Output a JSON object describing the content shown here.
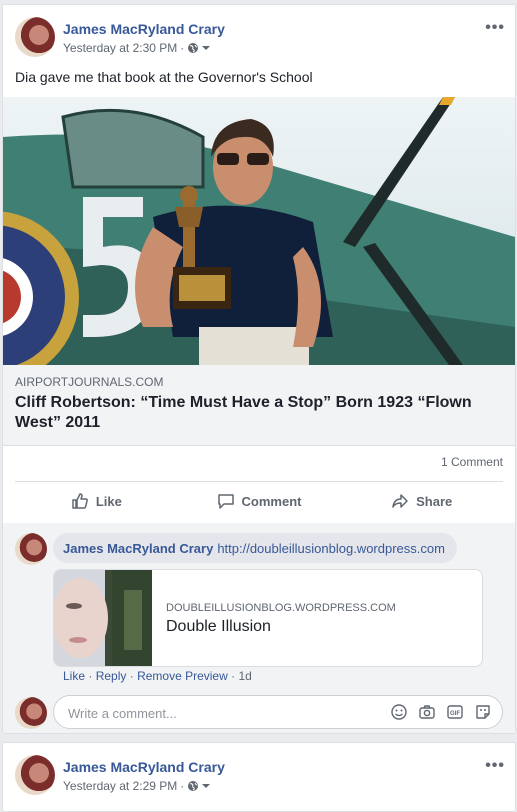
{
  "post1": {
    "author": "James MacRyland Crary",
    "timestamp": "Yesterday at 2:30 PM",
    "privacy_icon": "globe-icon",
    "more_label": "•••",
    "text": "Dia gave me that book at the Governor's School",
    "link": {
      "domain": "AIRPORTJOURNALS.COM",
      "title": "Cliff Robertson: “Time Must Have a Stop” Born 1923 “Flown West” 2011"
    },
    "comment_count": "1 Comment",
    "actions": {
      "like": "Like",
      "comment": "Comment",
      "share": "Share"
    },
    "comment": {
      "author": "James MacRyland Crary",
      "link_text": "http://doubleillusionblog.wordpress.com",
      "preview": {
        "domain": "DOUBLEILLUSIONBLOG.WORDPRESS.COM",
        "title": "Double Illusion"
      },
      "actions": {
        "like": "Like",
        "reply": "Reply",
        "remove_preview": "Remove Preview",
        "age": "1d"
      }
    },
    "write_placeholder": "Write a comment..."
  },
  "post2": {
    "author": "James MacRyland Crary",
    "timestamp": "Yesterday at 2:29 PM",
    "more_label": "•••"
  },
  "colors": {
    "link": "#385898",
    "muted": "#606770",
    "background": "#e9ebee"
  }
}
